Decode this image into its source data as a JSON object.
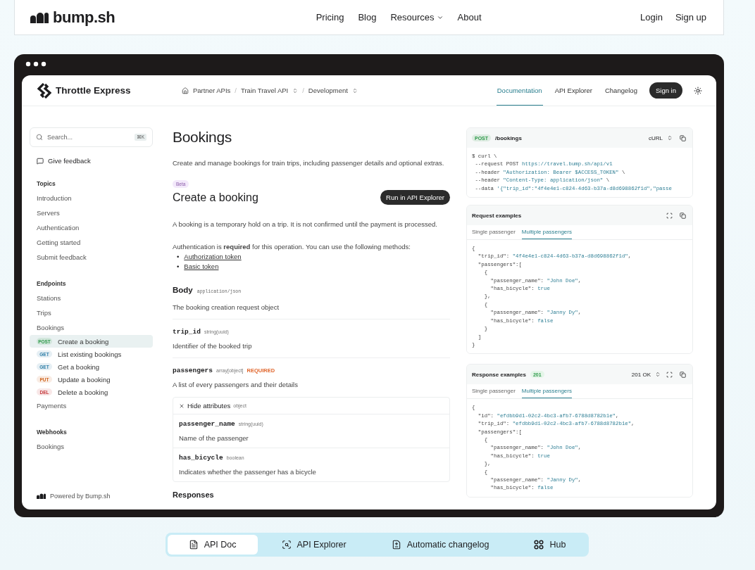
{
  "site_nav": {
    "logo": "bump.sh",
    "links": [
      {
        "label": "Pricing",
        "has_menu": false
      },
      {
        "label": "Blog",
        "has_menu": false
      },
      {
        "label": "Resources",
        "has_menu": true
      },
      {
        "label": "About",
        "has_menu": false
      }
    ],
    "actions": [
      "Login",
      "Sign up"
    ]
  },
  "app": {
    "brand": "Throttle Express",
    "breadcrumb": [
      {
        "label": "Partner APIs",
        "kind": "home"
      },
      {
        "separator": "/",
        "label": "Train Travel API",
        "kind": "switch"
      },
      {
        "separator": "/",
        "label": "Development",
        "kind": "switch"
      }
    ],
    "tabs": [
      {
        "label": "Documentation",
        "selected": true
      },
      {
        "label": "API Explorer",
        "selected": false
      },
      {
        "label": "Changelog",
        "selected": false
      }
    ],
    "sign_in": "Sign in",
    "sidebar": {
      "search": {
        "placeholder": "Search...",
        "shortcut": "⌘K"
      },
      "feedback": "Give feedback",
      "sections": [
        {
          "title": "Topics",
          "items": [
            {
              "label": "Introduction"
            },
            {
              "label": "Servers"
            },
            {
              "label": "Authentication"
            },
            {
              "label": "Getting started"
            },
            {
              "label": "Submit feedback"
            }
          ]
        },
        {
          "title": "Endpoints",
          "items": [
            {
              "label": "Stations"
            },
            {
              "label": "Trips"
            },
            {
              "label": "Bookings",
              "children": [
                {
                  "method": "POST",
                  "color": "#2e9a4a",
                  "label": "Create a booking",
                  "selected": true
                },
                {
                  "method": "GET",
                  "color": "#2f7fa8",
                  "label": "List existing bookings",
                  "selected": false
                },
                {
                  "method": "GET",
                  "color": "#2f7fa8",
                  "label": "Get a booking",
                  "selected": false
                },
                {
                  "method": "PUT",
                  "color": "#d0661e",
                  "label": "Update a booking",
                  "selected": false
                },
                {
                  "method": "DEL",
                  "color": "#c4373b",
                  "label": "Delete a booking",
                  "selected": false
                }
              ]
            },
            {
              "label": "Payments"
            }
          ]
        },
        {
          "title": "Webhooks",
          "items": [
            {
              "label": "Bookings"
            }
          ]
        }
      ],
      "footer": "Powered by Bump.sh"
    },
    "main": {
      "title": "Bookings",
      "intro": "Create and manage bookings for train trips, including passenger details and optional extras.",
      "badge": "Beta",
      "operation_title": "Create a booking",
      "run_button": "Run in API Explorer",
      "description": "A booking is a temporary hold on a trip. It is not confirmed until the payment is processed.",
      "auth_text": "Authentication is **required** for this operation. You can use the following methods:",
      "auth_methods": [
        {
          "bullet": "•",
          "label": "Authorization token"
        },
        {
          "bullet": "•",
          "label": "Basic token"
        }
      ],
      "body": {
        "title": "Body",
        "media_type": "application/json",
        "description": "The booking creation request object"
      },
      "params": [
        {
          "name": "trip_id",
          "type": "string(uuid)",
          "description": "Identifier of the booked trip"
        },
        {
          "name": "passengers",
          "type": "array[object]",
          "required": "REQUIRED",
          "description": "A list of every passengers and their details",
          "attributes": {
            "toggle": "Hide attributes",
            "type": "object",
            "fields": [
              {
                "name": "passenger_name",
                "type": "string(uuid)",
                "description": "Name of the passenger"
              },
              {
                "name": "has_bicycle",
                "type": "boolean",
                "description": "Indicates whether the passenger has a bicycle"
              }
            ]
          }
        }
      ],
      "responses_title": "Responses"
    },
    "request_sample": {
      "method": "POST",
      "color": "#2e9a4a",
      "path": "/bookings",
      "language": "cURL",
      "code": [
        [
          {
            "text": "$ curl \\",
            "kind": "plain"
          }
        ],
        [
          {
            "text": " --request POST ",
            "kind": "plain"
          },
          {
            "text": "https://travel.bump.sh/api/v1",
            "kind": "str"
          }
        ],
        [
          {
            "text": " --header ",
            "kind": "plain"
          },
          {
            "text": "\"Authorization: Bearer $ACCESS_TOKEN\"",
            "kind": "str"
          },
          {
            "text": " \\",
            "kind": "plain"
          }
        ],
        [
          {
            "text": " --header ",
            "kind": "plain"
          },
          {
            "text": "\"Content-Type: application/json\"",
            "kind": "str"
          },
          {
            "text": " \\",
            "kind": "plain"
          }
        ],
        [
          {
            "text": " --data ",
            "kind": "plain"
          },
          {
            "text": "'{\"trip_id\":\"4f4e4e1-c824-4d63-b37a-d8d698862f1d\",\"passe",
            "kind": "str"
          }
        ]
      ]
    },
    "request_examples": {
      "title": "Request examples",
      "tabs": [
        {
          "label": "Single passenger",
          "selected": false
        },
        {
          "label": "Multiple passengers",
          "selected": true
        }
      ],
      "code": [
        [
          {
            "text": "{",
            "kind": "plain"
          }
        ],
        [
          {
            "text": "  \"trip_id\": ",
            "kind": "plain"
          },
          {
            "text": "\"4f4e4e1-c824-4d63-b37a-d8d698862f1d\"",
            "kind": "str"
          },
          {
            "text": ",",
            "kind": "plain"
          }
        ],
        [
          {
            "text": "  \"passengers\":[",
            "kind": "plain"
          }
        ],
        [
          {
            "text": "    {",
            "kind": "plain"
          }
        ],
        [
          {
            "text": "      \"passenger_name\": ",
            "kind": "plain"
          },
          {
            "text": "\"John Doe\"",
            "kind": "str"
          },
          {
            "text": ",",
            "kind": "plain"
          }
        ],
        [
          {
            "text": "      \"has_bicycle\": ",
            "kind": "plain"
          },
          {
            "text": "true",
            "kind": "str"
          }
        ],
        [
          {
            "text": "    },",
            "kind": "plain"
          }
        ],
        [
          {
            "text": "    {",
            "kind": "plain"
          }
        ],
        [
          {
            "text": "      \"passenger_name\": ",
            "kind": "plain"
          },
          {
            "text": "\"Janny Dy\"",
            "kind": "str"
          },
          {
            "text": ",",
            "kind": "plain"
          }
        ],
        [
          {
            "text": "      \"has_bicycle\": ",
            "kind": "plain"
          },
          {
            "text": "false",
            "kind": "str"
          }
        ],
        [
          {
            "text": "    }",
            "kind": "plain"
          }
        ],
        [
          {
            "text": "  ]",
            "kind": "plain"
          }
        ],
        [
          {
            "text": "}",
            "kind": "plain"
          }
        ]
      ]
    },
    "response_examples": {
      "title": "Response examples",
      "status_badge": "201",
      "status": "201 OK",
      "tabs": [
        {
          "label": "Single passenger",
          "selected": false
        },
        {
          "label": "Multiple passengers",
          "selected": true
        }
      ],
      "code": [
        [
          {
            "text": "{",
            "kind": "plain"
          }
        ],
        [
          {
            "text": "  \"id\": ",
            "kind": "plain"
          },
          {
            "text": "\"efdbb9d1-02c2-4bc3-afb7-6788d8782b1e\"",
            "kind": "str"
          },
          {
            "text": ",",
            "kind": "plain"
          }
        ],
        [
          {
            "text": "  \"trip_id\": ",
            "kind": "plain"
          },
          {
            "text": "\"efdbb9d1-02c2-4bc3-afb7-6788d8782b1e\"",
            "kind": "str"
          },
          {
            "text": ",",
            "kind": "plain"
          }
        ],
        [
          {
            "text": "  \"passengers\":[",
            "kind": "plain"
          }
        ],
        [
          {
            "text": "    {",
            "kind": "plain"
          }
        ],
        [
          {
            "text": "      \"passenger_name\": ",
            "kind": "plain"
          },
          {
            "text": "\"John Doe\"",
            "kind": "str"
          },
          {
            "text": ",",
            "kind": "plain"
          }
        ],
        [
          {
            "text": "      \"has_bicycle\": ",
            "kind": "plain"
          },
          {
            "text": "true",
            "kind": "str"
          }
        ],
        [
          {
            "text": "    },",
            "kind": "plain"
          }
        ],
        [
          {
            "text": "    {",
            "kind": "plain"
          }
        ],
        [
          {
            "text": "      \"passenger_name\": ",
            "kind": "plain"
          },
          {
            "text": "\"Janny Dy\"",
            "kind": "str"
          },
          {
            "text": ",",
            "kind": "plain"
          }
        ],
        [
          {
            "text": "      \"has_bicycle\": ",
            "kind": "plain"
          },
          {
            "text": "false",
            "kind": "str"
          }
        ]
      ]
    }
  },
  "product_tabs": [
    {
      "label": "API Doc",
      "kind": "doc",
      "selected": true
    },
    {
      "label": "API Explorer",
      "kind": "explore",
      "selected": false
    },
    {
      "label": "Automatic changelog",
      "kind": "diff",
      "selected": false
    },
    {
      "label": "Hub",
      "kind": "hub",
      "selected": false
    }
  ]
}
